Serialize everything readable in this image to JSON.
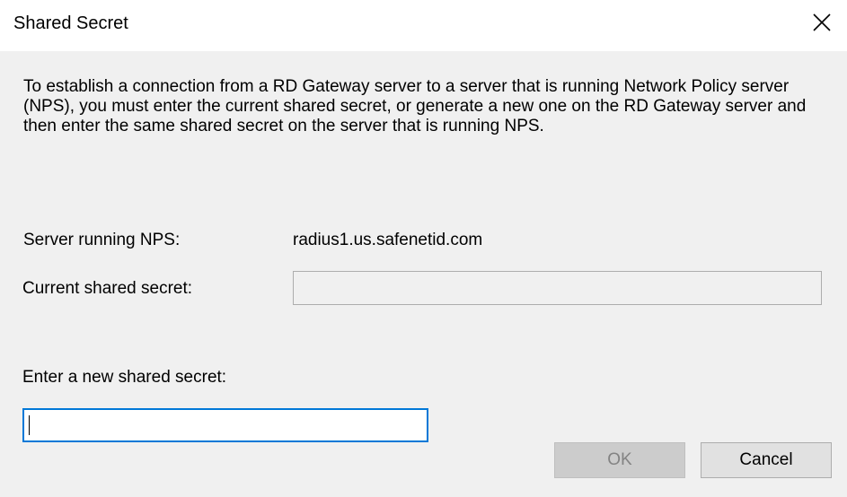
{
  "window": {
    "title": "Shared Secret",
    "close_icon": "close-icon"
  },
  "description": "To establish a connection from a RD Gateway server to a server that is running Network Policy server (NPS), you must enter the current shared secret, or generate a new one on the RD Gateway server and then enter the same shared secret on the server that is running NPS.",
  "server": {
    "label": "Server running NPS:",
    "value": "radius1.us.safenetid.com"
  },
  "current_secret": {
    "label": "Current shared secret:",
    "value": "",
    "enabled": false
  },
  "new_secret": {
    "label": "Enter a new shared secret:",
    "value": "",
    "focused": true
  },
  "buttons": {
    "ok_label": "OK",
    "ok_enabled": false,
    "cancel_label": "Cancel"
  }
}
